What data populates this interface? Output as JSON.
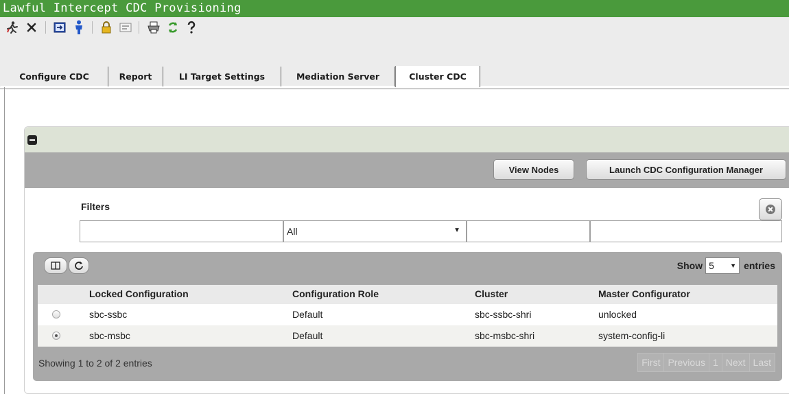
{
  "app": {
    "title": "Lawful Intercept CDC Provisioning"
  },
  "toolbar": {
    "buttons": [
      {
        "name": "exit-icon",
        "glyph": "🏃"
      },
      {
        "name": "close-icon",
        "glyph": "✖"
      },
      {
        "name": "import-icon",
        "glyph": "⇥"
      },
      {
        "name": "user-icon",
        "glyph": "👤"
      },
      {
        "name": "lock-icon",
        "glyph": "🔒"
      },
      {
        "name": "form-icon",
        "glyph": "▭"
      },
      {
        "name": "print-icon",
        "glyph": "🖶"
      },
      {
        "name": "refresh-icon",
        "glyph": "↻"
      },
      {
        "name": "help-icon",
        "glyph": "?"
      }
    ]
  },
  "tabs": [
    {
      "label": "Configure CDC",
      "active": false
    },
    {
      "label": "Report",
      "active": false
    },
    {
      "label": "LI Target Settings",
      "active": false
    },
    {
      "label": "Mediation Server",
      "active": false
    },
    {
      "label": "Cluster CDC",
      "active": true
    }
  ],
  "actions": {
    "view_nodes": "View Nodes",
    "launch_manager": "Launch CDC Configuration Manager"
  },
  "filters": {
    "label": "Filters",
    "locked_configuration": "",
    "configuration_role": "All",
    "cluster": "",
    "master_configurator": ""
  },
  "table": {
    "show_prefix": "Show",
    "page_size": "5",
    "show_suffix": "entries",
    "columns": [
      "Locked Configuration",
      "Configuration Role",
      "Cluster",
      "Master Configurator"
    ],
    "rows": [
      {
        "selected": false,
        "locked_configuration": "sbc-ssbc",
        "configuration_role": "Default",
        "cluster": "sbc-ssbc-shri",
        "master_configurator": "unlocked"
      },
      {
        "selected": true,
        "locked_configuration": "sbc-msbc",
        "configuration_role": "Default",
        "cluster": "sbc-msbc-shri",
        "master_configurator": "system-config-li"
      }
    ],
    "info": "Showing 1 to 2 of 2 entries",
    "pager": {
      "first": "First",
      "previous": "Previous",
      "page": "1",
      "next": "Next",
      "last": "Last"
    }
  }
}
